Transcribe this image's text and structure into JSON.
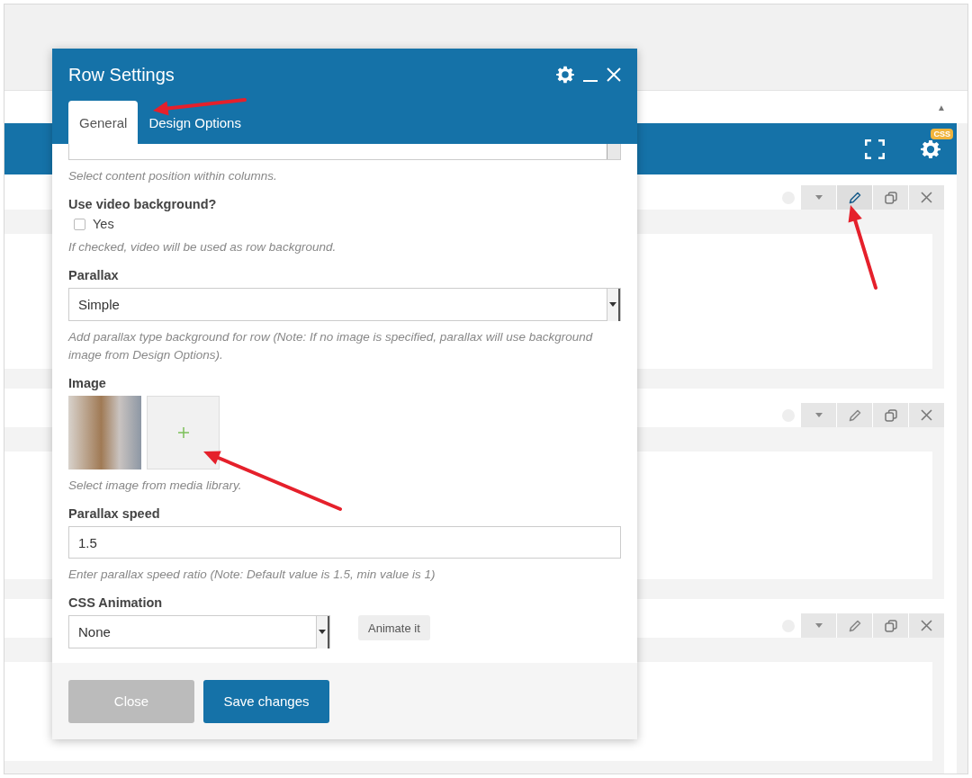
{
  "builder": {
    "collapse_toggle": "▲",
    "css_badge": "CSS"
  },
  "rows": [
    {
      "edit_active": true
    },
    {
      "edit_active": false
    },
    {
      "edit_active": false
    }
  ],
  "dialog": {
    "title": "Row Settings",
    "tabs": [
      {
        "label": "General",
        "selected": true
      },
      {
        "label": "Design Options",
        "selected": false
      }
    ],
    "fields": [
      {
        "kind": "cut-select",
        "hint": "Select content position within columns."
      },
      {
        "kind": "checkbox",
        "label": "Use video background?",
        "option": "Yes",
        "checked": false,
        "hint": "If checked, video will be used as row background."
      },
      {
        "kind": "select",
        "label": "Parallax",
        "value": "Simple",
        "hint": "Add parallax type background for row (Note: If no image is specified, parallax will use background image from Design Options)."
      },
      {
        "kind": "image",
        "label": "Image",
        "hint": "Select image from media library."
      },
      {
        "kind": "text",
        "label": "Parallax speed",
        "value": "1.5",
        "hint": "Enter parallax speed ratio (Note: Default value is 1.5, min value is 1)"
      },
      {
        "kind": "select-button",
        "label": "CSS Animation",
        "value": "None",
        "button": "Animate it"
      }
    ],
    "buttons": [
      {
        "label": "Close",
        "kind": "secondary"
      },
      {
        "label": "Save changes",
        "kind": "primary"
      }
    ]
  }
}
